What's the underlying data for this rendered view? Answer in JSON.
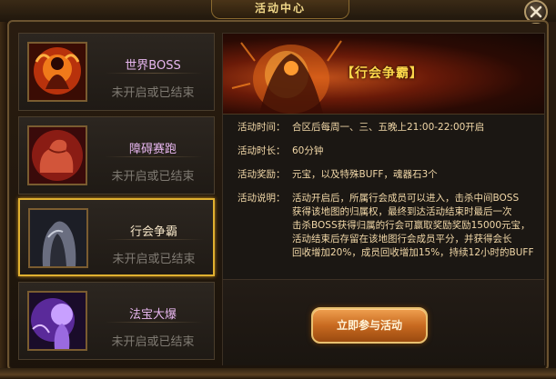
{
  "window": {
    "title": "活动中心"
  },
  "activities": [
    {
      "name": "世界BOSS",
      "status": "未开启或已结束",
      "icon": "burning-demon-icon",
      "selected": false
    },
    {
      "name": "障碍赛跑",
      "status": "未开启或已结束",
      "icon": "flexing-arm-icon",
      "selected": false
    },
    {
      "name": "行会争霸",
      "status": "未开启或已结束",
      "icon": "hooded-figure-icon",
      "selected": true
    },
    {
      "name": "法宝大爆",
      "status": "未开启或已结束",
      "icon": "purple-spirit-icon",
      "selected": false
    }
  ],
  "detail": {
    "banner_title": "【行会争霸】",
    "time_label": "活动时间：",
    "time_value": "合区后每周一、三、五晚上21:00-22:00开启",
    "duration_label": "活动时长：",
    "duration_value": "60分钟",
    "reward_label": "活动奖励：",
    "reward_value": "元宝，以及特殊BUFF，魂器石3个",
    "desc_label": "活动说明：",
    "desc_lines": [
      "活动开启后，所属行会成员可以进入，击杀中间BOSS",
      "获得该地图的归属权，最终到达活动结束时最后一次",
      "击杀BOSS获得归属的行会可赢取奖励奖励15000元宝，",
      "活动结束后存留在该地图行会成员平分，并获得会长",
      "回收增加20%，成员回收增加15%，持续12小时的BUFF"
    ],
    "join_button": "立即参与活动"
  },
  "colors": {
    "selected_border": "#e0b030",
    "activity_name": "#e8b7f0",
    "status_text": "#7f7a72",
    "info_text": "#f2d8a8",
    "banner_title": "#ffd84a"
  }
}
